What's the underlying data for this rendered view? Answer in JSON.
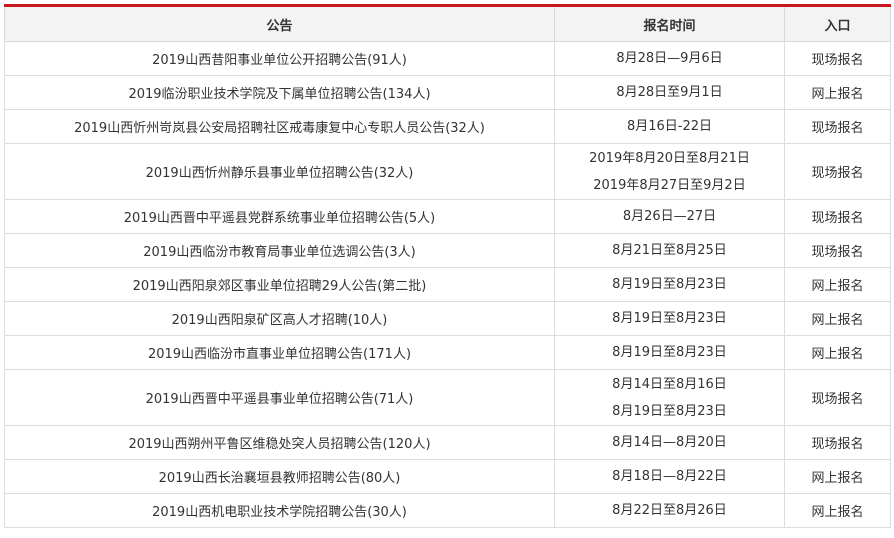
{
  "headers": {
    "notice": "公告",
    "time": "报名时间",
    "entry": "入口"
  },
  "rows": [
    {
      "notice": "2019山西昔阳事业单位公开招聘公告(91人)",
      "dates": [
        "8月28日—9月6日"
      ],
      "entry": "现场报名"
    },
    {
      "notice": "2019临汾职业技术学院及下属单位招聘公告(134人)",
      "dates": [
        "8月28日至9月1日"
      ],
      "entry": "网上报名"
    },
    {
      "notice": "2019山西忻州岢岚县公安局招聘社区戒毒康复中心专职人员公告(32人)",
      "dates": [
        "8月16日-22日"
      ],
      "entry": "现场报名"
    },
    {
      "notice": "2019山西忻州静乐县事业单位招聘公告(32人)",
      "dates": [
        "2019年8月20日至8月21日",
        "2019年8月27日至9月2日"
      ],
      "entry": "现场报名"
    },
    {
      "notice": "2019山西晋中平遥县党群系统事业单位招聘公告(5人)",
      "dates": [
        "8月26日—27日"
      ],
      "entry": "现场报名"
    },
    {
      "notice": "2019山西临汾市教育局事业单位选调公告(3人)",
      "dates": [
        "8月21日至8月25日"
      ],
      "entry": "现场报名"
    },
    {
      "notice": "2019山西阳泉郊区事业单位招聘29人公告(第二批)",
      "dates": [
        "8月19日至8月23日"
      ],
      "entry": "网上报名"
    },
    {
      "notice": "2019山西阳泉矿区高人才招聘(10人)",
      "dates": [
        "8月19日至8月23日"
      ],
      "entry": "网上报名"
    },
    {
      "notice": "2019山西临汾市直事业单位招聘公告(171人)",
      "dates": [
        "8月19日至8月23日"
      ],
      "entry": "网上报名"
    },
    {
      "notice": "2019山西晋中平遥县事业单位招聘公告(71人)",
      "dates": [
        "8月14日至8月16日",
        "8月19日至8月23日"
      ],
      "entry": "现场报名"
    },
    {
      "notice": "2019山西朔州平鲁区维稳处突人员招聘公告(120人)",
      "dates": [
        "8月14日—8月20日"
      ],
      "entry": "现场报名"
    },
    {
      "notice": "2019山西长治襄垣县教师招聘公告(80人)",
      "dates": [
        "8月18日—8月22日"
      ],
      "entry": "网上报名"
    },
    {
      "notice": "2019山西机电职业技术学院招聘公告(30人)",
      "dates": [
        "8月22日至8月26日"
      ],
      "entry": "网上报名"
    }
  ],
  "colors": {
    "accent": "#c9171e",
    "header_bg": "#f3f3f3",
    "border": "#dcdcdc"
  }
}
